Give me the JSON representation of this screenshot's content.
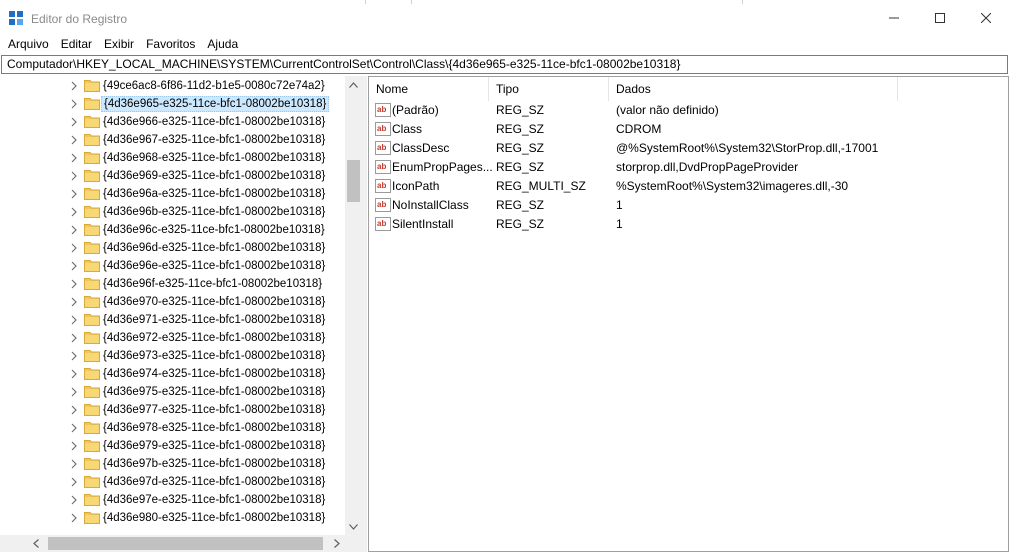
{
  "window": {
    "title": "Editor do Registro",
    "icon": "registry-editor-icon"
  },
  "menu": [
    "Arquivo",
    "Editar",
    "Exibir",
    "Favoritos",
    "Ajuda"
  ],
  "address": "Computador\\HKEY_LOCAL_MACHINE\\SYSTEM\\CurrentControlSet\\Control\\Class\\{4d36e965-e325-11ce-bfc1-08002be10318}",
  "tree": {
    "items": [
      "{49ce6ac8-6f86-11d2-b1e5-0080c72e74a2}",
      "{4d36e965-e325-11ce-bfc1-08002be10318}",
      "{4d36e966-e325-11ce-bfc1-08002be10318}",
      "{4d36e967-e325-11ce-bfc1-08002be10318}",
      "{4d36e968-e325-11ce-bfc1-08002be10318}",
      "{4d36e969-e325-11ce-bfc1-08002be10318}",
      "{4d36e96a-e325-11ce-bfc1-08002be10318}",
      "{4d36e96b-e325-11ce-bfc1-08002be10318}",
      "{4d36e96c-e325-11ce-bfc1-08002be10318}",
      "{4d36e96d-e325-11ce-bfc1-08002be10318}",
      "{4d36e96e-e325-11ce-bfc1-08002be10318}",
      "{4d36e96f-e325-11ce-bfc1-08002be10318}",
      "{4d36e970-e325-11ce-bfc1-08002be10318}",
      "{4d36e971-e325-11ce-bfc1-08002be10318}",
      "{4d36e972-e325-11ce-bfc1-08002be10318}",
      "{4d36e973-e325-11ce-bfc1-08002be10318}",
      "{4d36e974-e325-11ce-bfc1-08002be10318}",
      "{4d36e975-e325-11ce-bfc1-08002be10318}",
      "{4d36e977-e325-11ce-bfc1-08002be10318}",
      "{4d36e978-e325-11ce-bfc1-08002be10318}",
      "{4d36e979-e325-11ce-bfc1-08002be10318}",
      "{4d36e97b-e325-11ce-bfc1-08002be10318}",
      "{4d36e97d-e325-11ce-bfc1-08002be10318}",
      "{4d36e97e-e325-11ce-bfc1-08002be10318}",
      "{4d36e980-e325-11ce-bfc1-08002be10318}"
    ],
    "selected_index": 1
  },
  "values": {
    "columns": [
      "Nome",
      "Tipo",
      "Dados"
    ],
    "rows": [
      {
        "name": "(Padrão)",
        "type": "REG_SZ",
        "data": "(valor não definido)"
      },
      {
        "name": "Class",
        "type": "REG_SZ",
        "data": "CDROM"
      },
      {
        "name": "ClassDesc",
        "type": "REG_SZ",
        "data": "@%SystemRoot%\\System32\\StorProp.dll,-17001"
      },
      {
        "name": "EnumPropPages...",
        "type": "REG_SZ",
        "data": "storprop.dll,DvdPropPageProvider"
      },
      {
        "name": "IconPath",
        "type": "REG_MULTI_SZ",
        "data": "%SystemRoot%\\System32\\imageres.dll,-30"
      },
      {
        "name": "NoInstallClass",
        "type": "REG_SZ",
        "data": "1"
      },
      {
        "name": "SilentInstall",
        "type": "REG_SZ",
        "data": "1"
      }
    ]
  },
  "colors": {
    "selection": "#cce8ff",
    "folder": "#f0c75e",
    "string_icon": "#c0392b"
  }
}
